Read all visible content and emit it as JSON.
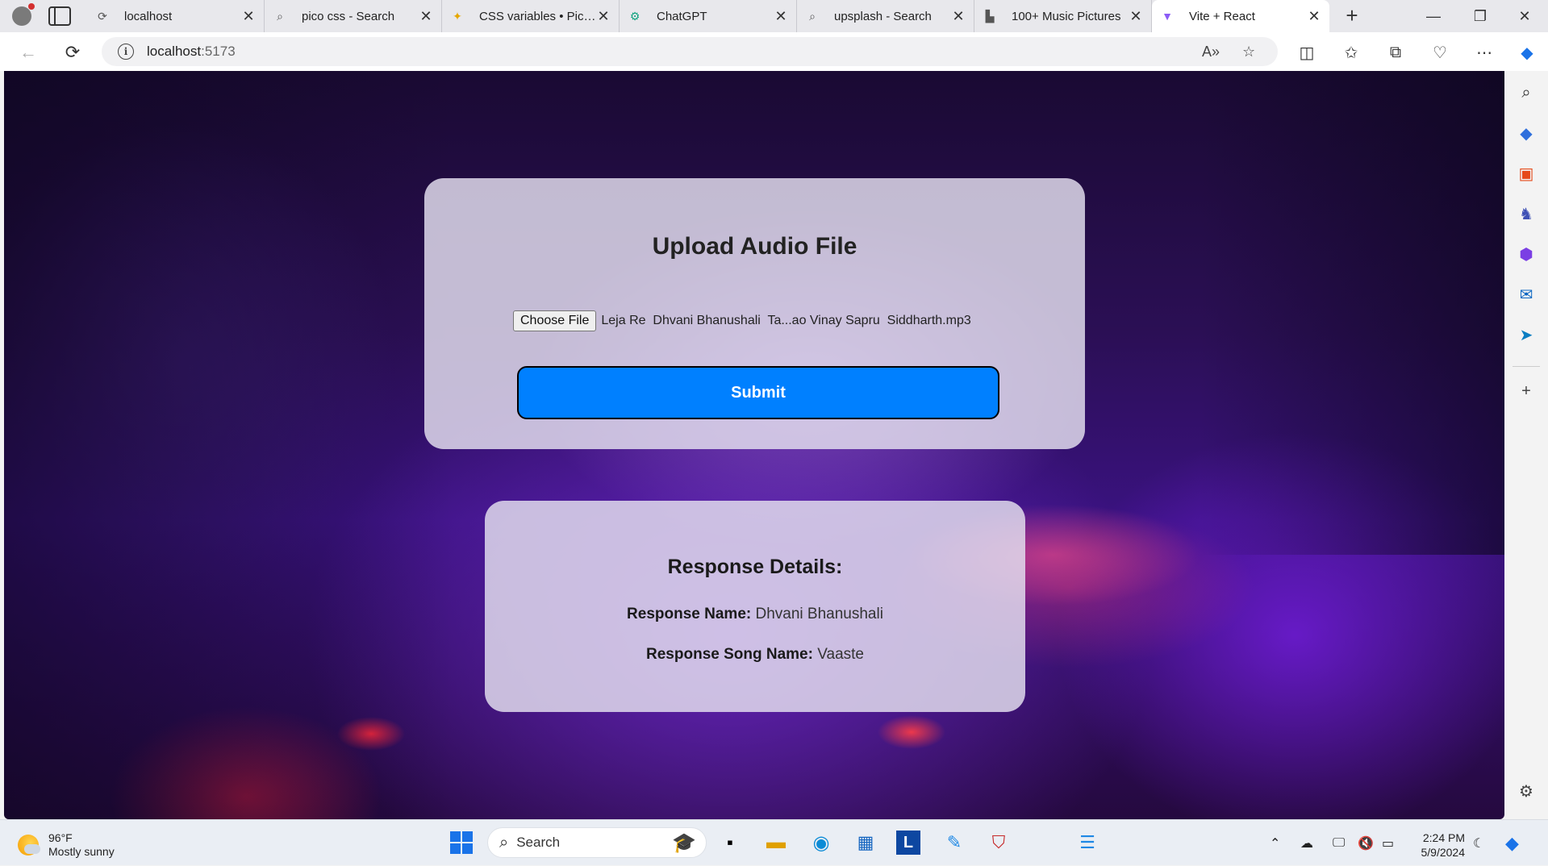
{
  "browser": {
    "tabs": [
      {
        "title": "localhost",
        "icon": "page-refresh-icon"
      },
      {
        "title": "pico css - Search",
        "icon": "search-icon"
      },
      {
        "title": "CSS variables • Pico CSS",
        "icon": "pico-icon"
      },
      {
        "title": "ChatGPT",
        "icon": "chatgpt-icon"
      },
      {
        "title": "upsplash - Search",
        "icon": "search-icon"
      },
      {
        "title": "100+ Music Pictures",
        "icon": "unsplash-icon"
      },
      {
        "title": "Vite + React",
        "icon": "vite-icon",
        "active": true
      }
    ],
    "address": {
      "host": "localhost",
      "port": ":5173"
    }
  },
  "upload": {
    "title": "Upload Audio File",
    "choose_file_label": "Choose File",
    "file_name": "Leja Re  Dhvani Bhanushali  Ta...ao Vinay Sapru  Siddharth.mp3",
    "submit_label": "Submit"
  },
  "response": {
    "heading": "Response Details:",
    "name_label": "Response Name:",
    "name_value": "Dhvani Bhanushali",
    "song_label": "Response Song Name:",
    "song_value": "Vaaste"
  },
  "taskbar": {
    "weather_temp": "96°F",
    "weather_desc": "Mostly sunny",
    "search_placeholder": "Search",
    "time": "2:24 PM",
    "date": "5/9/2024"
  },
  "colors": {
    "submit_bg": "#0080ff",
    "card_bg": "#e2deee"
  }
}
